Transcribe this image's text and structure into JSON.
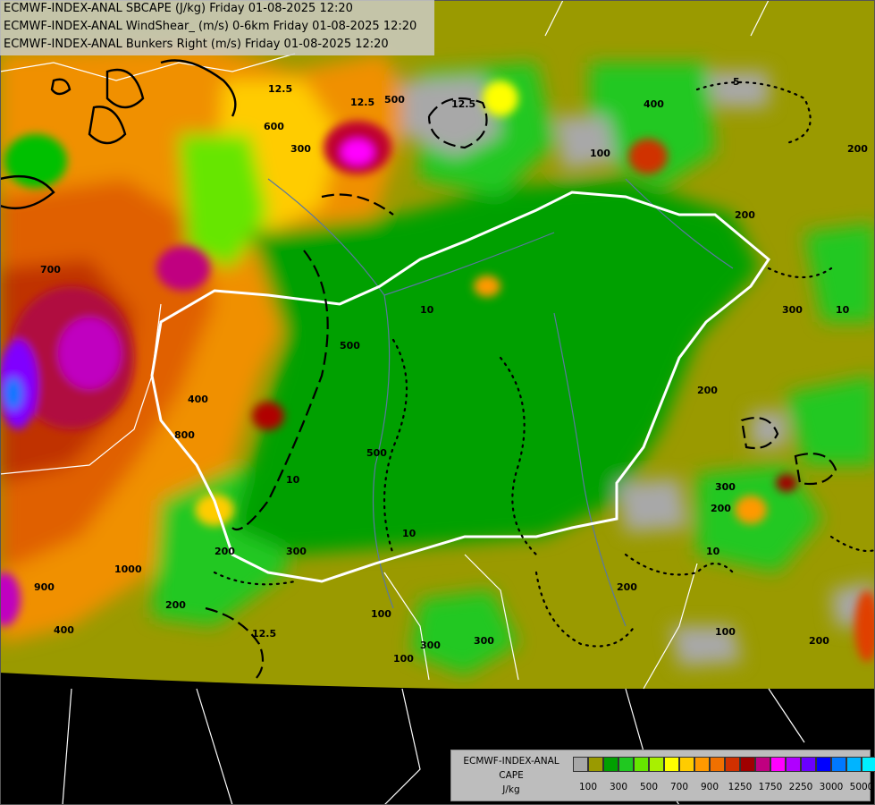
{
  "header": {
    "line1": "ECMWF-INDEX-ANAL SBCAPE (J/kg) Friday 01-08-2025 12:20",
    "line2": "ECMWF-INDEX-ANAL WindShear_ (m/s) 0-6km Friday 01-08-2025 12:20",
    "line3": "ECMWF-INDEX-ANAL Bunkers Right (m/s) Friday 01-08-2025 12:20"
  },
  "legend": {
    "title1": "ECMWF-INDEX-ANAL",
    "title2": "CAPE",
    "title3": "J/kg",
    "swatch_colors": [
      "#a8a8a8",
      "#9a9a00",
      "#00a000",
      "#20c820",
      "#66e600",
      "#a8f000",
      "#ffff00",
      "#ffcc00",
      "#ff9900",
      "#f07000",
      "#d03000",
      "#a00000",
      "#c00080",
      "#ff00ff",
      "#b000ff",
      "#6a00ff",
      "#0000ff",
      "#0078ff",
      "#00b4ff",
      "#00f0ff",
      "#a0ffff",
      "#ffffff"
    ],
    "tick_labels": [
      "100",
      "300",
      "500",
      "700",
      "900",
      "1250",
      "1750",
      "2250",
      "3000",
      "5000"
    ]
  },
  "contour_labels": [
    "12.5",
    "12.5",
    "12.5",
    "12.5",
    "10",
    "10",
    "10",
    "10",
    "10",
    "5",
    "100",
    "200",
    "300",
    "400",
    "500",
    "600",
    "700",
    "800",
    "900",
    "1000",
    "200",
    "300",
    "400",
    "500",
    "200",
    "300",
    "200",
    "200",
    "100",
    "200",
    "100",
    "200",
    "300",
    "300",
    "100",
    "200",
    "300",
    "500",
    "400"
  ],
  "colors": {
    "background": "#000000",
    "borders": "#ffffff",
    "rivers": "#5a78a0",
    "shear_contours": "#000000"
  }
}
